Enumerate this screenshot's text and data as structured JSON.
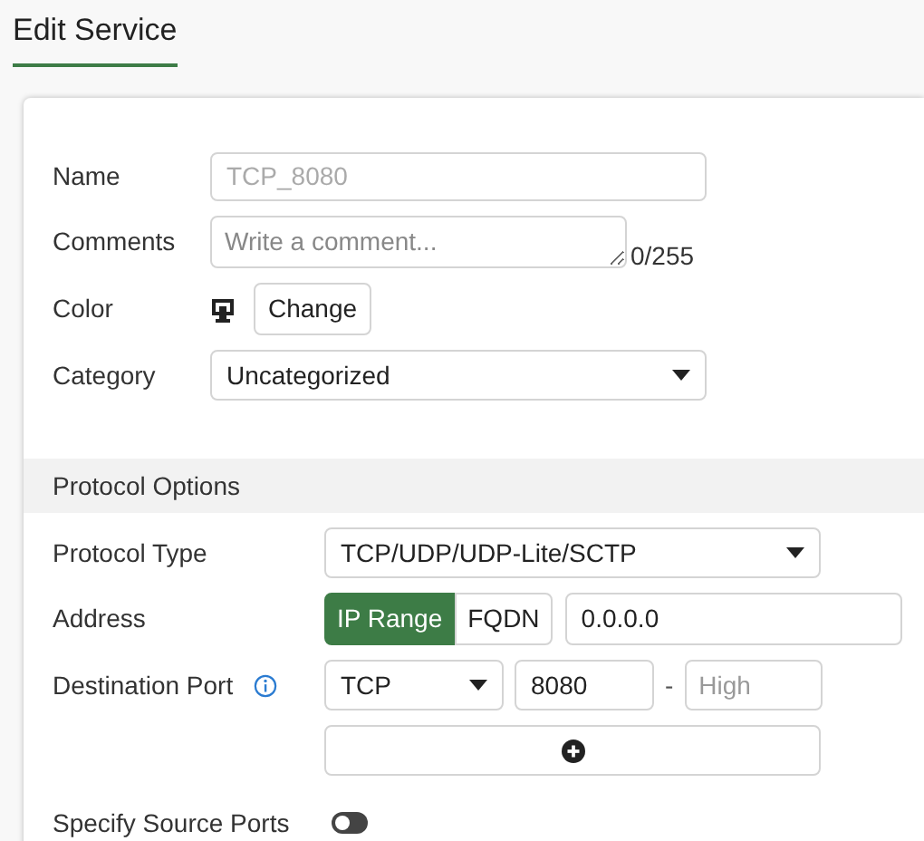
{
  "header": {
    "title": "Edit Service"
  },
  "general": {
    "name": {
      "label": "Name",
      "value": "TCP_8080",
      "disabled": true
    },
    "comments": {
      "label": "Comments",
      "placeholder": "Write a comment...",
      "counter": "0/255"
    },
    "color": {
      "label": "Color",
      "button": "Change"
    },
    "category": {
      "label": "Category",
      "value": "Uncategorized"
    }
  },
  "protocol_options": {
    "title": "Protocol Options",
    "protocol_type": {
      "label": "Protocol Type",
      "value": "TCP/UDP/UDP-Lite/SCTP"
    },
    "address": {
      "label": "Address",
      "modes": [
        {
          "label": "IP Range",
          "selected": true
        },
        {
          "label": "FQDN",
          "selected": false
        }
      ],
      "value": "0.0.0.0"
    },
    "destination_port": {
      "label": "Destination Port",
      "protocol": "TCP",
      "low": "8080",
      "separator": "-",
      "high_placeholder": "High"
    },
    "specify_source_ports": {
      "label": "Specify Source Ports",
      "on": false
    }
  }
}
